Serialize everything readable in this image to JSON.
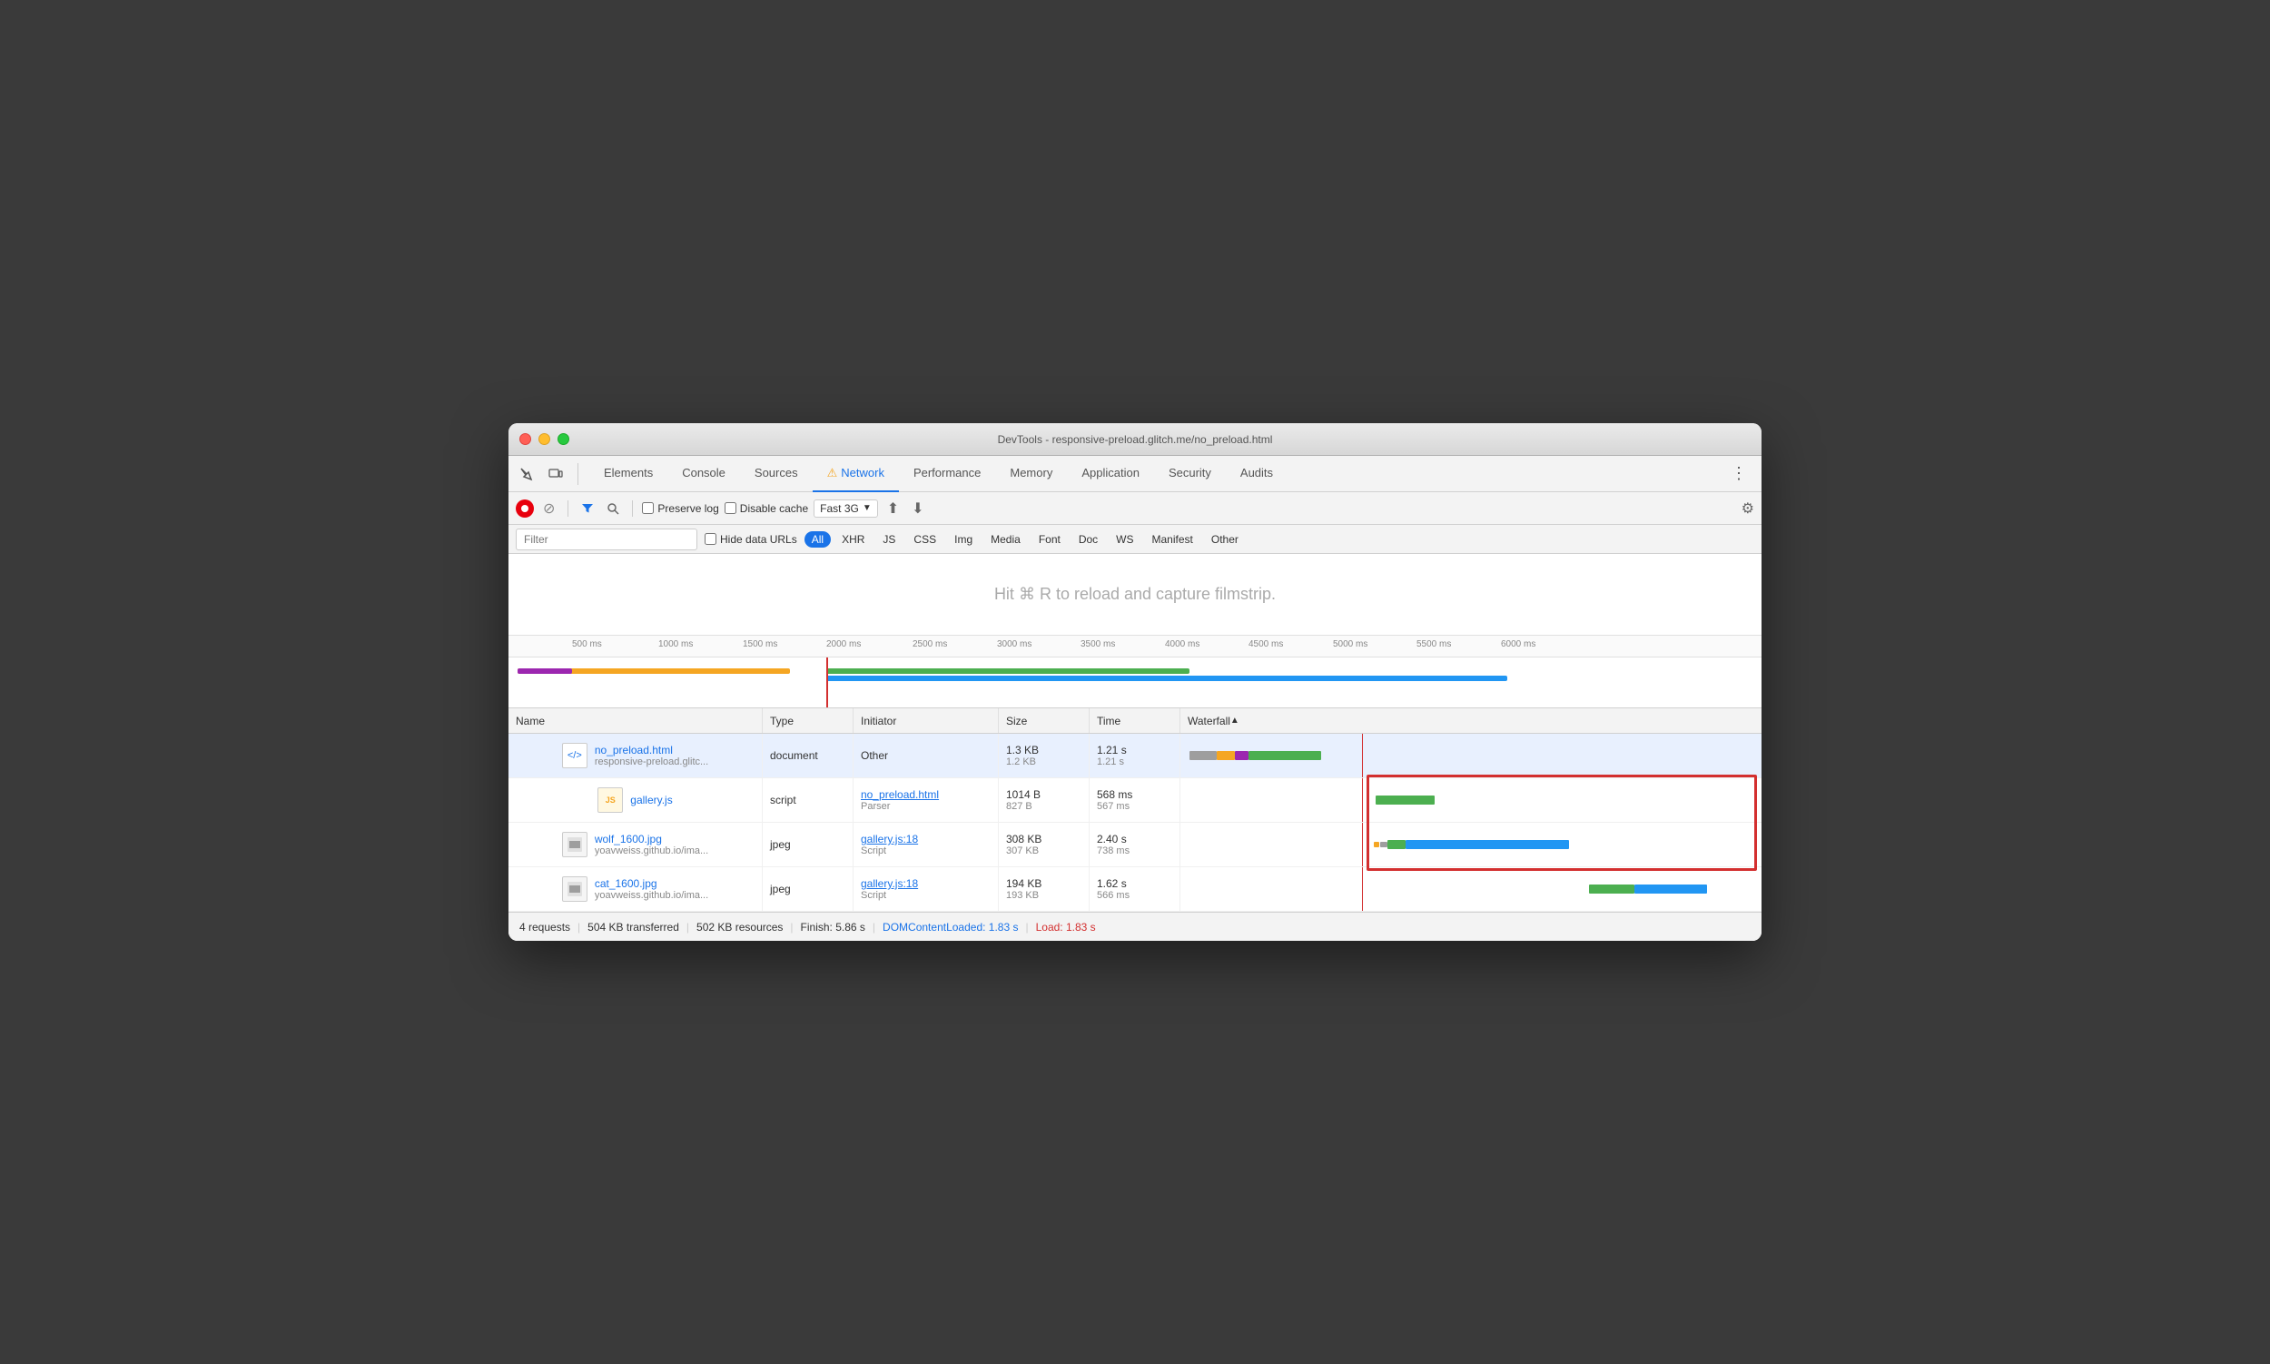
{
  "window": {
    "title": "DevTools - responsive-preload.glitch.me/no_preload.html"
  },
  "nav": {
    "tabs": [
      {
        "id": "elements",
        "label": "Elements",
        "active": false
      },
      {
        "id": "console",
        "label": "Console",
        "active": false
      },
      {
        "id": "sources",
        "label": "Sources",
        "active": false
      },
      {
        "id": "network",
        "label": "Network",
        "active": true,
        "warning": true
      },
      {
        "id": "performance",
        "label": "Performance",
        "active": false
      },
      {
        "id": "memory",
        "label": "Memory",
        "active": false
      },
      {
        "id": "application",
        "label": "Application",
        "active": false
      },
      {
        "id": "security",
        "label": "Security",
        "active": false
      },
      {
        "id": "audits",
        "label": "Audits",
        "active": false
      }
    ]
  },
  "toolbar": {
    "preserve_log": "Preserve log",
    "disable_cache": "Disable cache",
    "throttle": "Fast 3G"
  },
  "filter": {
    "placeholder": "Filter",
    "hide_data_urls": "Hide data URLs",
    "types": [
      "All",
      "XHR",
      "JS",
      "CSS",
      "Img",
      "Media",
      "Font",
      "Doc",
      "WS",
      "Manifest",
      "Other"
    ]
  },
  "filmstrip": {
    "message": "Hit ⌘ R to reload and capture filmstrip."
  },
  "timeline": {
    "ticks": [
      "500 ms",
      "1000 ms",
      "1500 ms",
      "2000 ms",
      "2500 ms",
      "3000 ms",
      "3500 ms",
      "4000 ms",
      "4500 ms",
      "5000 ms",
      "5500 ms",
      "6000 ms"
    ]
  },
  "table": {
    "headers": [
      "Name",
      "Type",
      "Initiator",
      "Size",
      "Time",
      "Waterfall"
    ],
    "rows": [
      {
        "icon": "</>",
        "name": "no_preload.html",
        "url": "responsive-preload.glitc...",
        "type": "document",
        "initiator": "Other",
        "initiator_sub": "",
        "size_primary": "1.3 KB",
        "size_secondary": "1.2 KB",
        "time_primary": "1.21 s",
        "time_secondary": "1.21 s",
        "selected": true
      },
      {
        "icon": "JS",
        "name": "gallery.js",
        "url": "",
        "type": "script",
        "initiator": "no_preload.html",
        "initiator_sub": "Parser",
        "size_primary": "1014 B",
        "size_secondary": "827 B",
        "time_primary": "568 ms",
        "time_secondary": "567 ms",
        "selected": false
      },
      {
        "icon": "IMG",
        "name": "wolf_1600.jpg",
        "url": "yoavweiss.github.io/ima...",
        "type": "jpeg",
        "initiator": "gallery.js:18",
        "initiator_sub": "Script",
        "size_primary": "308 KB",
        "size_secondary": "307 KB",
        "time_primary": "2.40 s",
        "time_secondary": "738 ms",
        "selected": false
      },
      {
        "icon": "IMG",
        "name": "cat_1600.jpg",
        "url": "yoavweiss.github.io/ima...",
        "type": "jpeg",
        "initiator": "gallery.js:18",
        "initiator_sub": "Script",
        "size_primary": "194 KB",
        "size_secondary": "193 KB",
        "time_primary": "1.62 s",
        "time_secondary": "566 ms",
        "selected": false
      }
    ]
  },
  "status_bar": {
    "requests": "4 requests",
    "transferred": "504 KB transferred",
    "resources": "502 KB resources",
    "finish": "Finish: 5.86 s",
    "dom_loaded": "DOMContentLoaded: 1.83 s",
    "load": "Load: 1.83 s"
  }
}
